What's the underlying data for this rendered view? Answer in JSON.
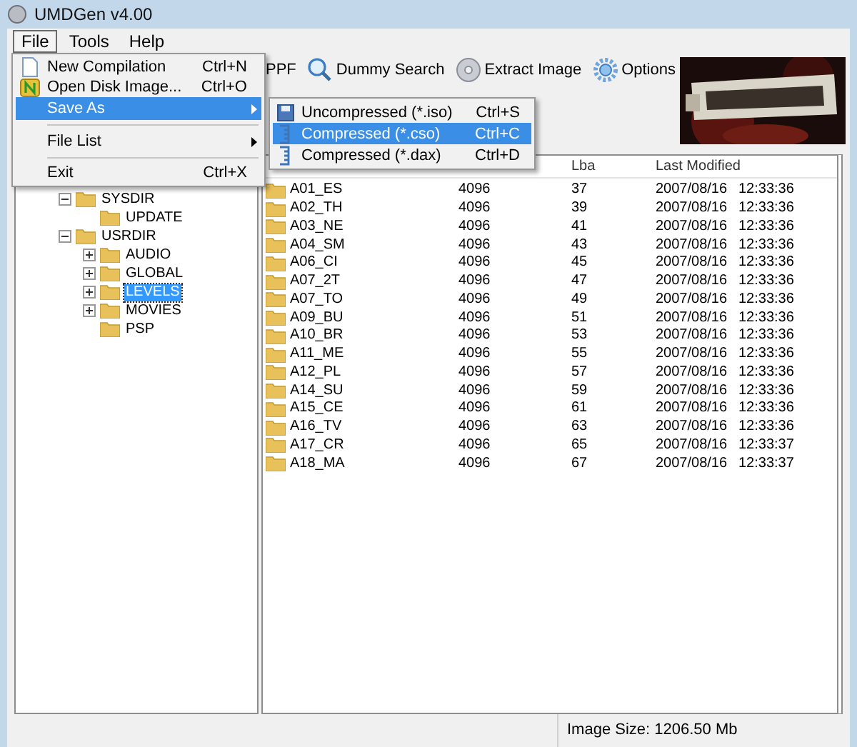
{
  "window": {
    "title": "UMDGen v4.00"
  },
  "menu_bar": [
    {
      "label": "File",
      "selected": true
    },
    {
      "label": "Tools",
      "selected": false
    },
    {
      "label": "Help",
      "selected": false
    }
  ],
  "toolbar": [
    {
      "kind": "text",
      "label": "PPF"
    },
    {
      "kind": "search",
      "label": "Dummy Search"
    },
    {
      "kind": "disc",
      "label": "Extract Image"
    },
    {
      "kind": "gear",
      "label": "Options"
    }
  ],
  "file_menu": [
    {
      "kind": "item",
      "label": "New Compilation",
      "shortcut": "Ctrl+N",
      "submenu": false,
      "selected": false
    },
    {
      "kind": "item",
      "label": "Open Disk Image...",
      "shortcut": "Ctrl+O",
      "submenu": false,
      "selected": false
    },
    {
      "kind": "item",
      "label": "Save As",
      "submenu": true,
      "selected": true
    },
    {
      "kind": "separator"
    },
    {
      "kind": "item",
      "label": "File List",
      "submenu": true,
      "selected": false
    },
    {
      "kind": "separator"
    },
    {
      "kind": "item",
      "label": "Exit",
      "shortcut": "Ctrl+X",
      "submenu": false,
      "selected": false
    }
  ],
  "save_as_menu": [
    {
      "label": "Uncompressed (*.iso)",
      "shortcut": "Ctrl+S",
      "selected": false
    },
    {
      "label": "Compressed (*.cso)",
      "shortcut": "Ctrl+C",
      "selected": true
    },
    {
      "label": "Compressed (*.dax)",
      "shortcut": "Ctrl+D",
      "selected": false
    }
  ],
  "tree": [
    {
      "label": "SYSDIR",
      "expanded": true,
      "selected": false,
      "children": [
        {
          "label": "UPDATE",
          "selected": false
        }
      ]
    },
    {
      "label": "USRDIR",
      "expanded": true,
      "selected": false,
      "children": [
        {
          "label": "AUDIO",
          "expanded": false,
          "selected": false
        },
        {
          "label": "GLOBAL",
          "expanded": false,
          "selected": false
        },
        {
          "label": "LEVELS",
          "expanded": false,
          "selected": true
        },
        {
          "label": "MOVIES",
          "expanded": false,
          "selected": false
        },
        {
          "label": "PSP",
          "selected": false
        }
      ]
    }
  ],
  "file_list": {
    "columns": [
      "Lba",
      "Last Modified"
    ],
    "rows": [
      {
        "name": "A01_ES",
        "size": "4096",
        "lba": "37",
        "date": "2007/08/16",
        "time": "12:33:36"
      },
      {
        "name": "A02_TH",
        "size": "4096",
        "lba": "39",
        "date": "2007/08/16",
        "time": "12:33:36"
      },
      {
        "name": "A03_NE",
        "size": "4096",
        "lba": "41",
        "date": "2007/08/16",
        "time": "12:33:36"
      },
      {
        "name": "A04_SM",
        "size": "4096",
        "lba": "43",
        "date": "2007/08/16",
        "time": "12:33:36"
      },
      {
        "name": "A06_CI",
        "size": "4096",
        "lba": "45",
        "date": "2007/08/16",
        "time": "12:33:36"
      },
      {
        "name": "A07_2T",
        "size": "4096",
        "lba": "47",
        "date": "2007/08/16",
        "time": "12:33:36"
      },
      {
        "name": "A07_TO",
        "size": "4096",
        "lba": "49",
        "date": "2007/08/16",
        "time": "12:33:36"
      },
      {
        "name": "A09_BU",
        "size": "4096",
        "lba": "51",
        "date": "2007/08/16",
        "time": "12:33:36"
      },
      {
        "name": "A10_BR",
        "size": "4096",
        "lba": "53",
        "date": "2007/08/16",
        "time": "12:33:36"
      },
      {
        "name": "A11_ME",
        "size": "4096",
        "lba": "55",
        "date": "2007/08/16",
        "time": "12:33:36"
      },
      {
        "name": "A12_PL",
        "size": "4096",
        "lba": "57",
        "date": "2007/08/16",
        "time": "12:33:36"
      },
      {
        "name": "A14_SU",
        "size": "4096",
        "lba": "59",
        "date": "2007/08/16",
        "time": "12:33:36"
      },
      {
        "name": "A15_CE",
        "size": "4096",
        "lba": "61",
        "date": "2007/08/16",
        "time": "12:33:36"
      },
      {
        "name": "A16_TV",
        "size": "4096",
        "lba": "63",
        "date": "2007/08/16",
        "time": "12:33:36"
      },
      {
        "name": "A17_CR",
        "size": "4096",
        "lba": "65",
        "date": "2007/08/16",
        "time": "12:33:37"
      },
      {
        "name": "A18_MA",
        "size": "4096",
        "lba": "67",
        "date": "2007/08/16",
        "time": "12:33:37"
      }
    ]
  },
  "status_bar": {
    "image_size": "Image Size: 1206.50 Mb"
  }
}
